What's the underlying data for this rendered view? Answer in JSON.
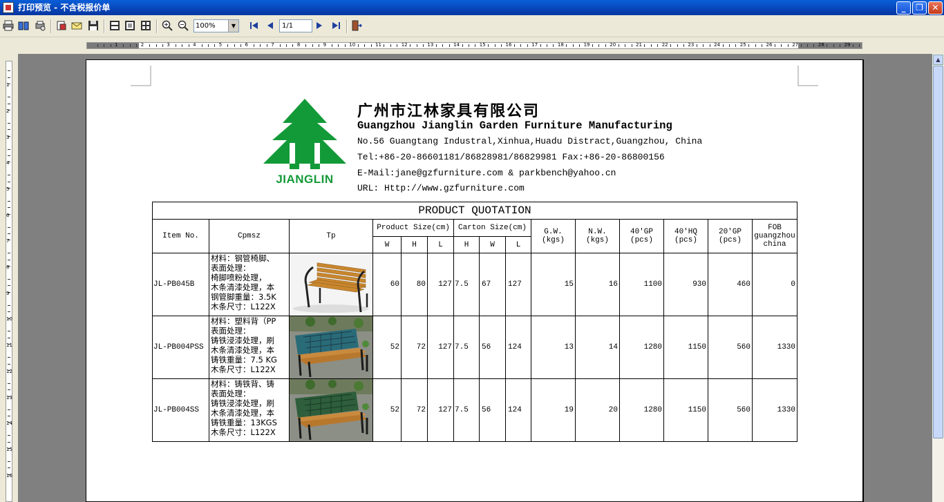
{
  "window": {
    "title": "打印预览 - 不含税报价单",
    "minimize": "_",
    "restore": "❐",
    "close": "✕"
  },
  "toolbar": {
    "zoom_value": "100%",
    "page_value": "1/1"
  },
  "ruler": {
    "h_numbers": [
      "1",
      "2",
      "3",
      "4",
      "5",
      "6",
      "7",
      "8",
      "9",
      "10",
      "11",
      "12",
      "13",
      "14",
      "15",
      "16",
      "17",
      "18",
      "19",
      "20",
      "21",
      "22",
      "23",
      "24",
      "25",
      "26",
      "27",
      "28",
      "29"
    ],
    "v_numbers": [
      "1",
      "2",
      "3",
      "4",
      "5",
      "6",
      "7",
      "8",
      "9",
      "10",
      "11",
      "12",
      "13",
      "14",
      "15",
      "16"
    ]
  },
  "company": {
    "logo_text": "JIANGLIN",
    "name_cn": "广州市江林家具有限公司",
    "name_en": "Guangzhou Jianglin Garden Furniture Manufacturing",
    "address": "No.56 Guangtang Industral,Xinhua,Huadu Distract,Guangzhou, China",
    "tel": "Tel:+86-20-86601181/86828981/86829981  Fax:+86-20-86800156",
    "email": "E-Mail:jane@gzfurniture.com & parkbench@yahoo.cn",
    "url": "URL: Http://www.gzfurniture.com",
    "brand_color": "#139a38"
  },
  "quotation": {
    "title": "PRODUCT QUOTATION",
    "headers": {
      "item_no": "Item No.",
      "cpmsz": "Cpmsz",
      "tp": "Tp",
      "product_size": "Product Size(cm)",
      "carton_size": "Carton Size(cm)",
      "gw": "G.W.\n(kgs)",
      "nw": "N.W.\n(kgs)",
      "gp40": "40'GP\n(pcs)",
      "hq40": "40'HQ\n(pcs)",
      "gp20": "20'GP\n(pcs)",
      "fob": "FOB\nguangzhou\nchina",
      "ps_sub": [
        "W",
        "H",
        "L"
      ],
      "cs_sub": [
        "H",
        "W",
        "L"
      ]
    },
    "rows": [
      {
        "item_no": "JL-PB045B",
        "desc": [
          "材料：钢管椅脚、",
          "表面处理：",
          "椅脚喷粉处理，",
          "木条清漆处理，本",
          "钢管脚重量：3.5K",
          "木条尺寸：L122X"
        ],
        "photo_icon": "bench-photo-icon",
        "pw": "60",
        "ph": "80",
        "pl": "127",
        "ch": "7.5",
        "cw": "67",
        "cl": "127",
        "gw": "15",
        "nw": "16",
        "gp40": "1100",
        "hq40": "930",
        "gp20": "460",
        "fob": "0"
      },
      {
        "item_no": "JL-PB004PSS",
        "desc": [
          "材料：塑料背（PP",
          "表面处理：",
          "铸铁浸漆处理，刷",
          "木条清漆处理，本",
          "铸铁重量：7.5 KG",
          "木条尺寸：L122X"
        ],
        "photo_icon": "bench-photo-icon",
        "pw": "52",
        "ph": "72",
        "pl": "127",
        "ch": "7.5",
        "cw": "56",
        "cl": "124",
        "gw": "13",
        "nw": "14",
        "gp40": "1280",
        "hq40": "1150",
        "gp20": "560",
        "fob": "1330"
      },
      {
        "item_no": "JL-PB004SS",
        "desc": [
          "材料：铸铁背、铸",
          "表面处理：",
          "铸铁浸漆处理，刷",
          "木条清漆处理，本",
          "铸铁重量：13KGS",
          "木条尺寸：L122X"
        ],
        "photo_icon": "bench-photo-icon",
        "pw": "52",
        "ph": "72",
        "pl": "127",
        "ch": "7.5",
        "cw": "56",
        "cl": "124",
        "gw": "19",
        "nw": "20",
        "gp40": "1280",
        "hq40": "1150",
        "gp20": "560",
        "fob": "1330"
      }
    ]
  }
}
